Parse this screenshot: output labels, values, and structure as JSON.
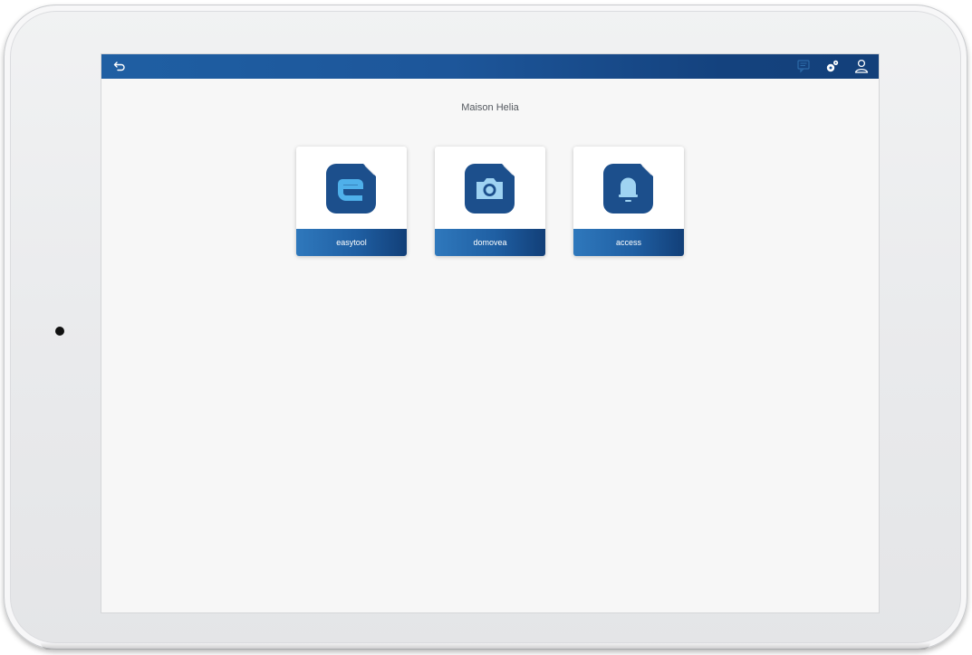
{
  "app": {
    "house_name": "Maison Helia"
  },
  "toolbar": {
    "icons": [
      "back-icon",
      "message-icon",
      "settings-gear-icon",
      "user-icon"
    ]
  },
  "apps": [
    {
      "label": "easytool",
      "icon": "easytool-e-icon"
    },
    {
      "label": "domovea",
      "icon": "camera-icon"
    },
    {
      "label": "access",
      "icon": "bell-icon"
    }
  ],
  "colors": {
    "topbar": "#1d569a",
    "tile_icon": "#1c4f8c",
    "screen_bg": "#f7f7f7",
    "device_frame": "#eceded"
  }
}
